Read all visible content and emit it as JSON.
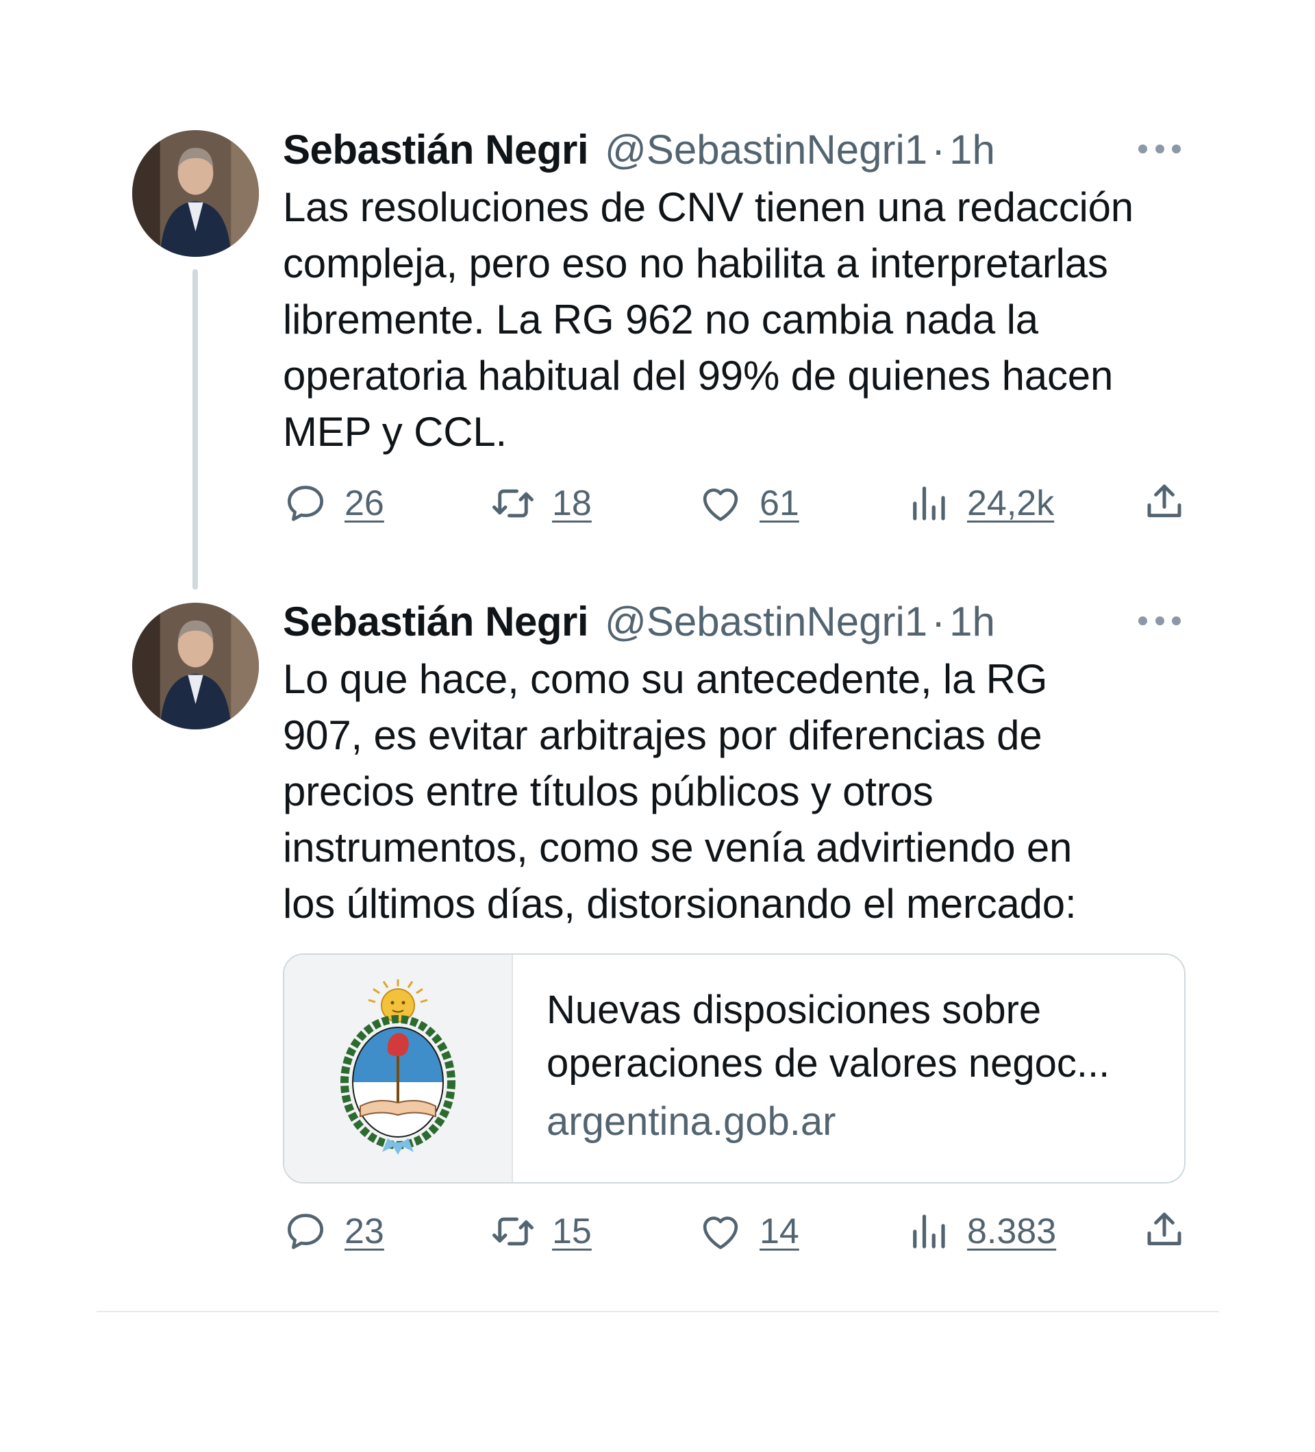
{
  "tweets": [
    {
      "author_name": "Sebastián Negri",
      "handle": "@SebastinNegri1",
      "separator": "·",
      "time": "1h",
      "text_lines": [
        "Las resoluciones de CNV tienen una redacción",
        "compleja, pero eso no habilita a interpretarlas",
        "libremente. La RG 962 no cambia nada la",
        "operatoria habitual del 99% de quienes hacen",
        "MEP y CCL."
      ],
      "replies": "26",
      "retweets": "18",
      "likes": "61",
      "views": "24,2k"
    },
    {
      "author_name": "Sebastián Negri",
      "handle": "@SebastinNegri1",
      "separator": "·",
      "time": "1h",
      "text_lines": [
        "Lo que hace, como su antecedente, la RG",
        "907, es evitar arbitrajes por diferencias de",
        "precios entre títulos públicos y otros",
        "instrumentos, como se venía advirtiendo en",
        "los últimos días, distorsionando el mercado:"
      ],
      "link_card": {
        "title_lines": [
          "Nuevas disposiciones sobre",
          "operaciones de valores negoc..."
        ],
        "domain": "argentina.gob.ar",
        "thumbnail": "argentina-coat-of-arms"
      },
      "replies": "23",
      "retweets": "15",
      "likes": "14",
      "views": "8.383"
    }
  ],
  "icons": {
    "reply": "speech-bubble-icon",
    "retweet": "retweet-arrows-icon",
    "like": "heart-icon",
    "views": "bar-chart-icon",
    "share": "share-upload-icon",
    "more": "ellipsis-icon"
  },
  "colors": {
    "text_primary": "#0f1419",
    "text_secondary": "#536471",
    "border": "#cfd9de"
  }
}
